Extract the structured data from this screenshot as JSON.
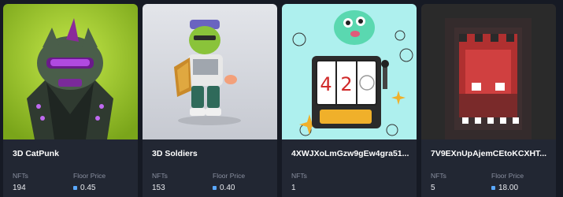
{
  "collections": [
    {
      "title": "3D CatPunk",
      "nfts_label": "NFTs",
      "nfts": "194",
      "floor_label": "Floor Price",
      "floor": "0.45",
      "art": "catpunk"
    },
    {
      "title": "3D Soldiers",
      "nfts_label": "NFTs",
      "nfts": "153",
      "floor_label": "Floor Price",
      "floor": "0.40",
      "art": "soldier"
    },
    {
      "title": "4XWJXoLmGzw9gEw4gra51...",
      "nfts_label": "NFTs",
      "nfts": "1",
      "floor_label": "",
      "floor": "",
      "art": "slot-machine",
      "slot_digits": [
        "4",
        "2"
      ]
    },
    {
      "title": "7V9EXnUpAjemCEtoKCXHT...",
      "nfts_label": "NFTs",
      "nfts": "5",
      "floor_label": "Floor Price",
      "floor": "18.00",
      "art": "pixel-ghost"
    }
  ],
  "icons": {
    "price": "coin-icon"
  },
  "colors": {
    "card_bg": "#222733",
    "page_bg": "#161a24",
    "label": "#8a90a0",
    "coin": "#5aa8ff"
  }
}
